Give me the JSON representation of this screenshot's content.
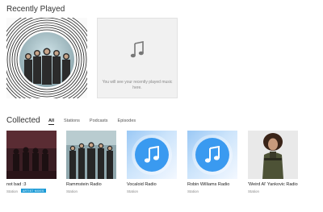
{
  "recently_played": {
    "title": "Recently Played",
    "placeholder_text": "You will see your recently played music here."
  },
  "collected": {
    "title": "Collected",
    "tabs": [
      {
        "label": "All",
        "active": true
      },
      {
        "label": "Stations",
        "active": false
      },
      {
        "label": "Podcasts",
        "active": false
      },
      {
        "label": "Episodes",
        "active": false
      }
    ],
    "items": [
      {
        "title": "not bad :3",
        "subtitle": "Station",
        "badge": "ARTIST MIXES"
      },
      {
        "title": "Rammstein Radio",
        "subtitle": "Station"
      },
      {
        "title": "Vocaloid Radio",
        "subtitle": "Station"
      },
      {
        "title": "Robin Williams Radio",
        "subtitle": "Station"
      },
      {
        "title": "'Weird Al' Yankovic Radio",
        "subtitle": "Station"
      }
    ]
  },
  "colors": {
    "accent": "#1a9ad6",
    "note_blue": "#3a9af0"
  },
  "icons": [
    "music-note-icon"
  ]
}
